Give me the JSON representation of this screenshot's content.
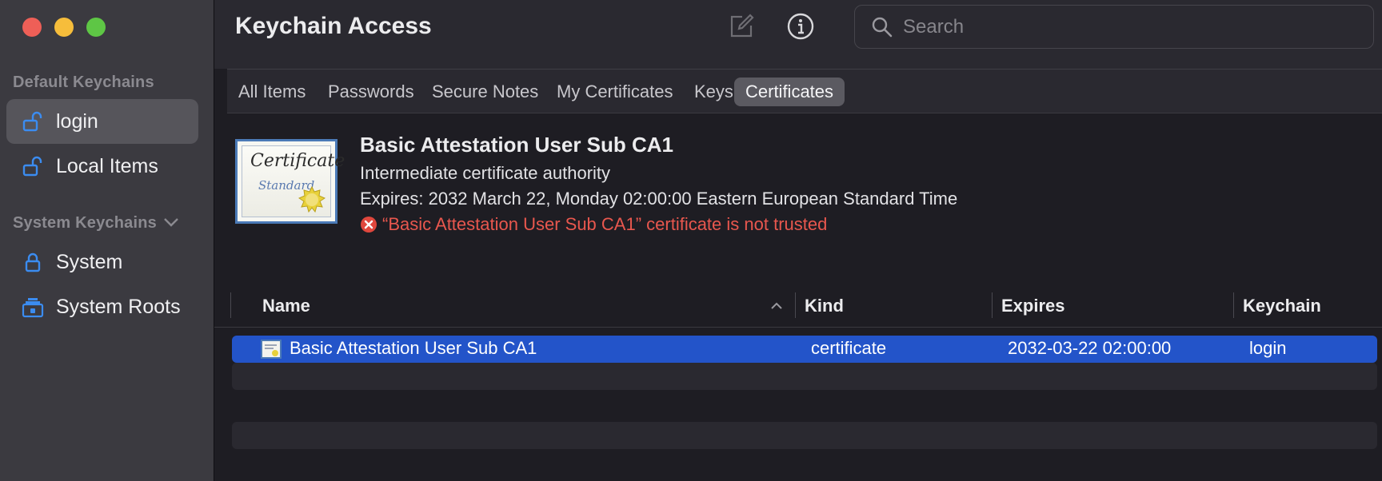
{
  "window": {
    "title": "Keychain Access"
  },
  "toolbar": {
    "edit_icon": "compose-icon",
    "info_icon": "info-icon",
    "search_placeholder": "Search"
  },
  "sidebar": {
    "default_label": "Default Keychains",
    "system_label": "System Keychains",
    "default_items": [
      {
        "label": "login",
        "icon": "unlocked-padlock-icon",
        "selected": true
      },
      {
        "label": "Local Items",
        "icon": "unlocked-padlock-icon",
        "selected": false
      }
    ],
    "system_items": [
      {
        "label": "System",
        "icon": "locked-padlock-icon"
      },
      {
        "label": "System Roots",
        "icon": "stacked-lock-icon"
      }
    ]
  },
  "tabs": [
    {
      "label": "All Items",
      "active": false
    },
    {
      "label": "Passwords",
      "active": false
    },
    {
      "label": "Secure Notes",
      "active": false
    },
    {
      "label": "My Certificates",
      "active": false
    },
    {
      "label": "Keys",
      "active": false
    },
    {
      "label": "Certificates",
      "active": true
    }
  ],
  "detail": {
    "cert_image_title": "Certificate",
    "cert_image_subtitle": "Standard",
    "name": "Basic Attestation User Sub CA1",
    "kind": "Intermediate certificate authority",
    "expires": "Expires: 2032 March 22, Monday 02:00:00 Eastern European Standard Time",
    "warning": "“Basic Attestation User Sub CA1” certificate is not trusted"
  },
  "table": {
    "columns": [
      "Name",
      "Kind",
      "Expires",
      "Keychain"
    ],
    "rows": [
      {
        "name": "Basic Attestation User Sub CA1",
        "kind": "certificate",
        "expires": "2032-03-22 02:00:00",
        "keychain": "login"
      }
    ]
  },
  "colors": {
    "selection": "#2354c9",
    "warning": "#e8574e",
    "accent_icon": "#3b8cf0"
  }
}
